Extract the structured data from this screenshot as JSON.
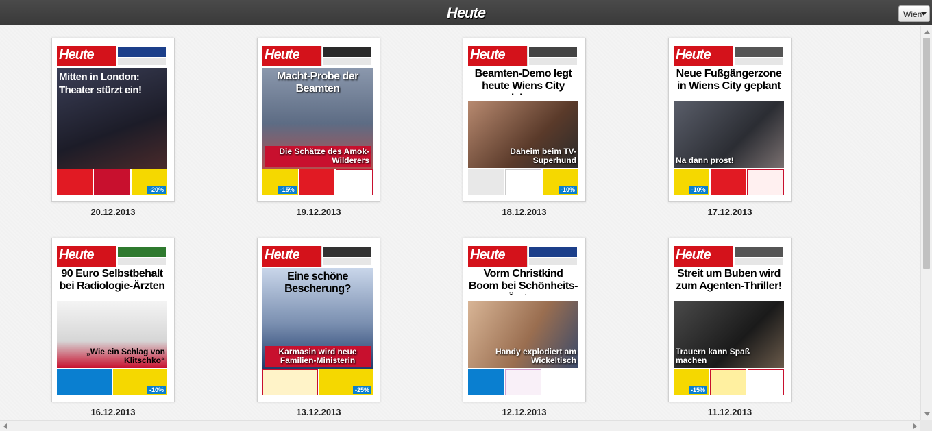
{
  "app": {
    "brand": "Heute"
  },
  "region_select": {
    "selected": "Wien"
  },
  "issues": [
    {
      "date": "20.12.2013",
      "headline": "Mitten in London: Theater stürzt ein!",
      "caption": "",
      "photo_color": "#2a2a3a",
      "accent": "#c8102e"
    },
    {
      "date": "19.12.2013",
      "headline": "Macht-Probe der Beamten",
      "caption": "Die Schätze des Amok-Wilderers",
      "photo_color": "#6f7e96",
      "accent": "#c8102e"
    },
    {
      "date": "18.12.2013",
      "headline": "Beamten-Demo legt heute Wiens City lahm",
      "caption": "Daheim beim TV-Superhund",
      "photo_color": "#8a6b57",
      "accent": "#c8102e"
    },
    {
      "date": "17.12.2013",
      "headline": "Neue Fußgängerzone in Wiens City geplant",
      "caption": "Na dann prost!",
      "photo_color": "#3b3e46",
      "accent": "#c8102e"
    },
    {
      "date": "16.12.2013",
      "headline": "90 Euro Selbstbehalt bei Radiologie-Ärzten",
      "caption": "„Wie ein Schlag von Klitschko“",
      "photo_color": "#e8e8e8",
      "accent": "#c8102e"
    },
    {
      "date": "13.12.2013",
      "headline": "Eine schöne Bescherung?",
      "caption": "Karmasin wird neue Familien-Ministerin",
      "photo_color": "#7a8fb0",
      "accent": "#c8102e"
    },
    {
      "date": "12.12.2013",
      "headline": "Vorm Christkind Boom bei Schönheits-Ärzten",
      "caption": "Handy explodiert am Wickeltisch",
      "photo_color": "#b08a6a",
      "accent": "#c8102e"
    },
    {
      "date": "11.12.2013",
      "headline": "Streit um Buben wird zum Agenten-Thriller!",
      "caption": "Trauern kann Spaß machen",
      "photo_color": "#2b2b2b",
      "accent": "#c8102e"
    }
  ]
}
